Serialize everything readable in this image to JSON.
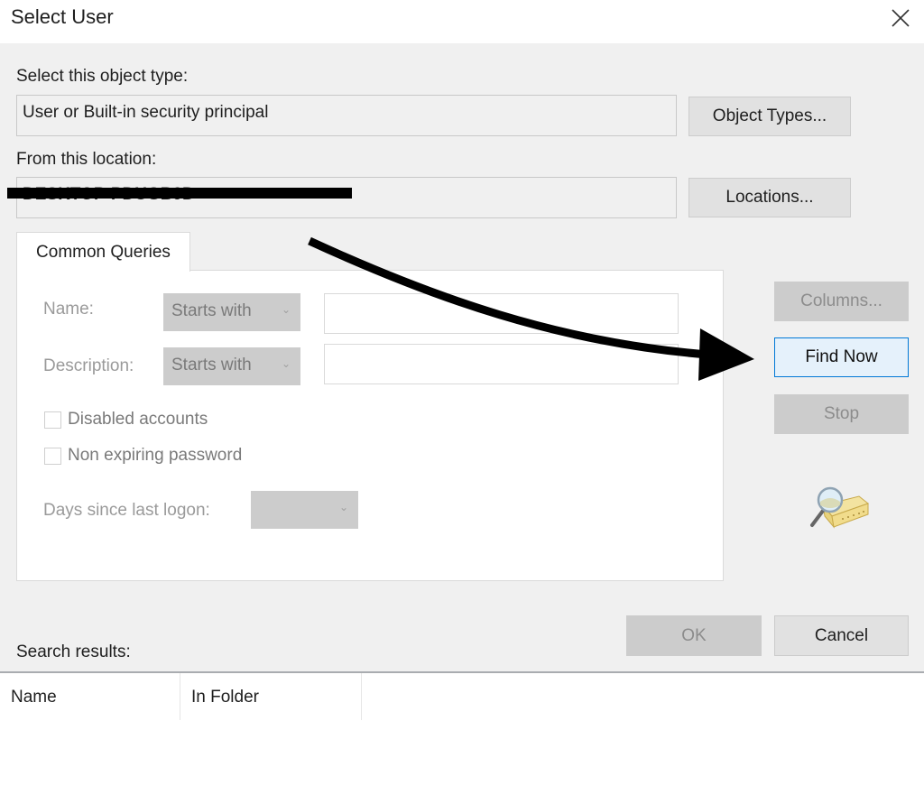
{
  "window": {
    "title": "Select User",
    "close_icon": "close-x-icon"
  },
  "object_type": {
    "label": "Select this object type:",
    "value": "User or Built-in security principal",
    "button": "Object Types..."
  },
  "location": {
    "label": "From this location:",
    "value": "DESKTOP-PDUGB9D",
    "redacted": true,
    "button": "Locations..."
  },
  "tabs": [
    {
      "label": "Common Queries",
      "active": true
    }
  ],
  "common_queries": {
    "name_label": "Name:",
    "name_match": "Starts with",
    "name_value": "",
    "description_label": "Description:",
    "description_match": "Starts with",
    "description_value": "",
    "disabled_accounts_label": "Disabled accounts",
    "disabled_accounts_checked": false,
    "non_expiring_label": "Non expiring password",
    "non_expiring_checked": false,
    "days_label": "Days since last logon:",
    "days_value": ""
  },
  "side_buttons": {
    "columns": "Columns...",
    "find_now": "Find Now",
    "stop": "Stop",
    "search_icon": "directory-search-icon"
  },
  "dialog_buttons": {
    "ok": "OK",
    "cancel": "Cancel"
  },
  "results": {
    "label": "Search results:",
    "columns": [
      "Name",
      "In Folder"
    ],
    "rows": []
  },
  "annotation": {
    "type": "curved-arrow",
    "points_to": "Find Now",
    "color": "#000000"
  },
  "colors": {
    "dialog_bg": "#f0f0f0",
    "focus_border": "#0078d7",
    "focus_bg": "#e5f1fb",
    "disabled_bg": "#cccccc"
  }
}
